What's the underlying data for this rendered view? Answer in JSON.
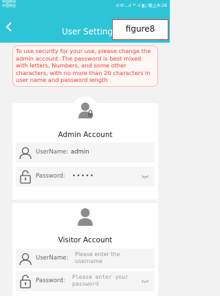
{
  "status_bar": {
    "carrier_line1": "中国移动",
    "carrier_line2": "中国电信",
    "right_text": "⊙☏ᵢ..ıl ⁴ᴳ.ıl ▮▯ 晚上8:28"
  },
  "header": {
    "back_icon": "chevron-left-icon",
    "title": "User Setting",
    "figure_label": "figure8"
  },
  "notice": "To use security for your use, please change the admin account. The password is best mixed with letters, Numbers, and some other characters, with no more than 20 characters in user name and password length",
  "admin": {
    "title": "Admin Account",
    "username_label": "UserName:",
    "username_value": "admin",
    "password_label": "Password:",
    "password_value": "•••••"
  },
  "visitor": {
    "title": "Visitor Account",
    "username_label": "UserName:",
    "username_placeholder": "Please enter the username",
    "password_label": "Password:",
    "password_placeholder": "Please enter your password"
  },
  "colors": {
    "accent": "#2ec4d8",
    "notice_text": "#e3452f",
    "notice_border": "#ffb3b3",
    "figure_border": "#d93a2b"
  }
}
